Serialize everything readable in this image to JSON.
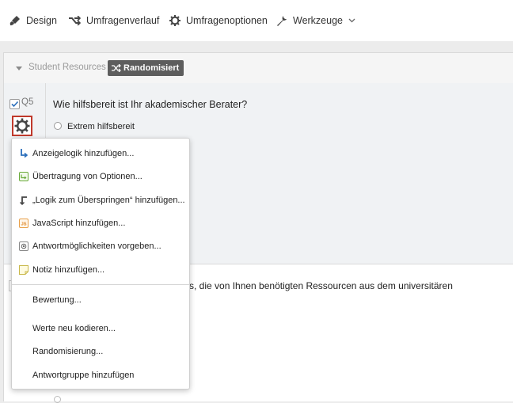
{
  "toolbar": {
    "design": "Design",
    "history": "Umfragenverlauf",
    "options": "Umfragenoptionen",
    "tools": "Werkzeuge"
  },
  "block": {
    "title": "Student Resources",
    "randomized_badge": "Randomisiert"
  },
  "question": {
    "number": "Q5",
    "text": "Wie hilfsbereit ist Ihr akademischer Berater?",
    "visible_option": "Extrem hilfsbereit"
  },
  "next_question": {
    "text_fragment": "s, die von Ihnen benötigten Ressourcen aus dem universitären"
  },
  "menu": {
    "items": [
      {
        "label": "Anzeigelogik hinzufügen...",
        "icon": "display-logic-icon"
      },
      {
        "label": "Übertragung von Optionen...",
        "icon": "carry-forward-icon"
      },
      {
        "label": "„Logik zum Überspringen“ hinzufügen...",
        "icon": "skip-logic-icon"
      },
      {
        "label": "JavaScript hinzufügen...",
        "icon": "javascript-icon"
      },
      {
        "label": "Antwortmöglichkeiten vorgeben...",
        "icon": "default-choices-icon"
      },
      {
        "label": "Notiz hinzufügen...",
        "icon": "note-icon"
      },
      {
        "label": "Bewertung..."
      },
      {
        "label": "Werte neu kodieren..."
      },
      {
        "label": "Randomisierung..."
      },
      {
        "label": "Antwortgruppe hinzufügen"
      }
    ]
  },
  "colors": {
    "highlight_border": "#c0392b",
    "badge_bg": "#5d5d5d",
    "checkbox_check": "#2a6ebb"
  }
}
